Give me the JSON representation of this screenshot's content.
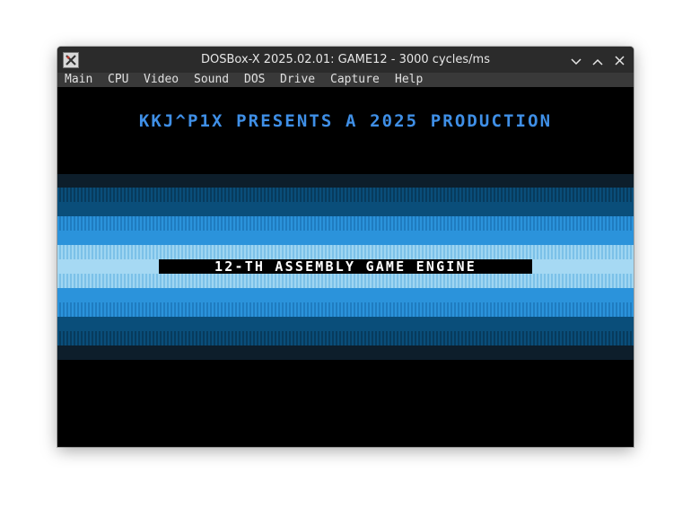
{
  "window": {
    "title": "DOSBox-X 2025.02.01: GAME12 - 3000 cycles/ms",
    "icon": "dosbox-x-icon",
    "controls": [
      "minimize-icon",
      "maximize-icon",
      "close-icon"
    ]
  },
  "menu": {
    "items": [
      "Main",
      "CPU",
      "Video",
      "Sound",
      "DOS",
      "Drive",
      "Capture",
      "Help"
    ]
  },
  "game": {
    "presents_text": "KKJ^P1X PRESENTS A 2025 PRODUCTION",
    "engine_text": "12-TH ASSEMBLY GAME ENGINE",
    "colors": {
      "presents": "#3f8fe6",
      "band_dark": "#0a4e7a",
      "band_mid": "#2b93db",
      "band_light": "#9fd6f2",
      "background": "#000000"
    }
  }
}
